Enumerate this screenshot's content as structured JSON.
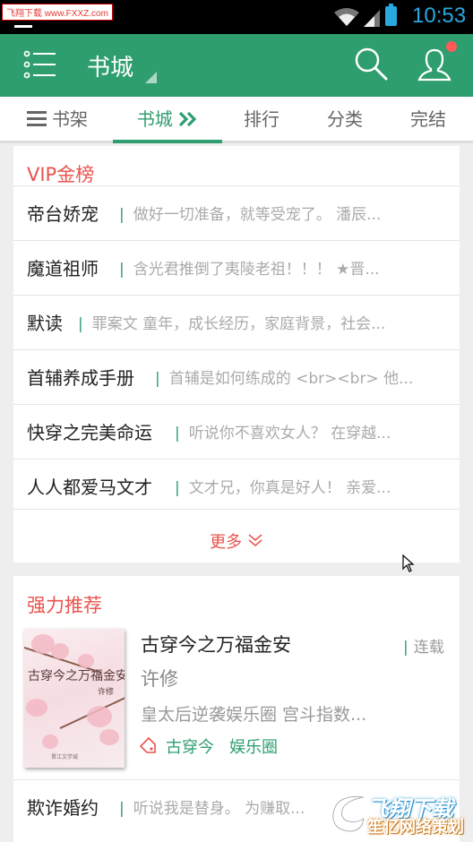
{
  "status_bar": {
    "watermark": "飞翔下载 www.FXXZ.com",
    "time": "10:53"
  },
  "app_bar": {
    "title": "书城",
    "notification_dot_color": "#ff5a5a",
    "theme_color": "#2e9e6e"
  },
  "tabs": [
    {
      "label": "书架",
      "icon": "shelf-icon"
    },
    {
      "label": "书城",
      "icon": "double-chevron-right-icon",
      "active": true
    },
    {
      "label": "排行"
    },
    {
      "label": "分类"
    },
    {
      "label": "完结"
    }
  ],
  "vip": {
    "title": "VIP金榜",
    "rows": [
      {
        "name": "帝台娇宠",
        "desc": "做好一切准备，就等受宠了。 潘辰..."
      },
      {
        "name": "魔道祖师",
        "desc": "含光君推倒了夷陵老祖！！！ ★晋..."
      },
      {
        "name": "默读",
        "desc": "罪案文 童年，成长经历，家庭背景，社会..."
      },
      {
        "name": "首辅养成手册",
        "desc": "首辅是如何练成的 <br><br> 他..."
      },
      {
        "name": "快穿之完美命运",
        "desc": "听说你不喜欢女人？ 在穿越..."
      },
      {
        "name": "人人都爱马文才",
        "desc": "文才兄，你真是好人！ 亲爱..."
      }
    ],
    "more_label": "更多"
  },
  "recommend": {
    "title": "强力推荐",
    "book": {
      "title": "古穿今之万福金安",
      "status": "连载",
      "author": "许修",
      "desc": "皇太后逆袭娱乐圈 宫斗指数...",
      "tags": [
        "古穿今",
        "娱乐圈"
      ],
      "cover_title": "古穿今之万福金安",
      "cover_author": "许修",
      "cover_publisher": "晋江文学城"
    },
    "next_row": {
      "name": "欺诈婚约",
      "desc": "听说我是替身。 为赚取..."
    }
  },
  "logo_watermark": {
    "line1": "飞翔下载",
    "line2": "笙亿网络策划"
  }
}
